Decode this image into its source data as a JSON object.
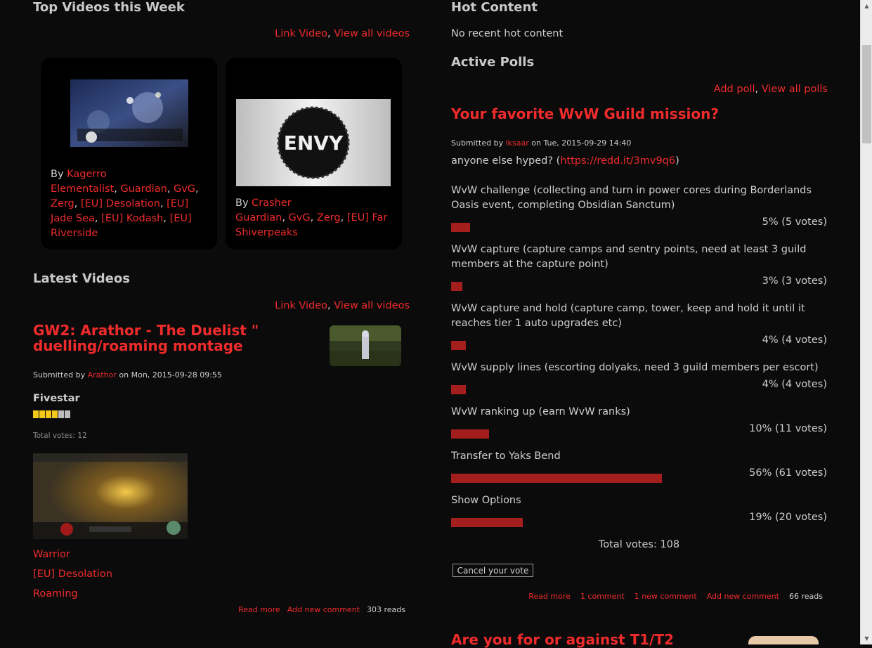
{
  "left": {
    "top_videos": {
      "heading": "Top Videos this Week",
      "link_video": "Link Video",
      "sep": ", ",
      "view_all": "View all videos",
      "cards": [
        {
          "by": "By ",
          "author": "Kagerro",
          "tags": [
            "Elementalist",
            "Guardian",
            "GvG",
            "Zerg",
            "[EU] Desolation",
            "[EU] Jade Sea",
            "[EU] Kodash",
            "[EU] Riverside"
          ]
        },
        {
          "by": "By ",
          "author": "Crasher",
          "tags": [
            "Guardian",
            "GvG",
            "Zerg",
            "[EU] Far Shiverpeaks"
          ],
          "logo_text": "ENVY"
        }
      ]
    },
    "latest_videos": {
      "heading": "Latest Videos",
      "link_video": "Link Video",
      "sep": ", ",
      "view_all": "View all videos",
      "post": {
        "title": "GW2: Arathor - The Duelist \" duelling/roaming montage",
        "submitted_by": "Submitted by ",
        "author": "Arathor",
        "date": " on Mon, 2015-09-28 09:55",
        "fivestar_label": "Fivestar",
        "rating": 4,
        "rating_max": 6,
        "total_votes": "Total votes: 12",
        "tags": [
          "Warrior",
          "[EU] Desolation",
          "Roaming"
        ],
        "read_more": "Read more",
        "add_comment": "Add new comment",
        "reads": "303 reads"
      }
    }
  },
  "right": {
    "hot_content": {
      "heading": "Hot Content",
      "empty": "No recent hot content"
    },
    "active_polls": {
      "heading": "Active Polls",
      "add_poll": "Add poll",
      "sep": ", ",
      "view_all": "View all polls",
      "poll": {
        "title": "Your favorite WvW Guild mission?",
        "submitted_by": "Submitted by ",
        "author": "lksaar",
        "date": " on Tue, 2015-09-29 14:40",
        "body_text": "anyone else hyped? (",
        "body_link": "https://redd.it/3mv9q6",
        "body_end": ")",
        "options": [
          {
            "label": "WvW challenge (collecting and turn in power cores during Borderlands Oasis event, completing Obsidian Sanctum)",
            "result": "5% (5 votes)",
            "percent": 5
          },
          {
            "label": "WvW capture (capture camps and sentry points, need at least 3 guild members at the capture point)",
            "result": "3% (3 votes)",
            "percent": 3
          },
          {
            "label": "WvW capture and hold (capture camp, tower, keep and hold it until it reaches tier 1 auto upgrades etc)",
            "result": "4% (4 votes)",
            "percent": 4
          },
          {
            "label": "WvW supply lines (escorting dolyaks, need 3 guild members per escort)",
            "result": "4% (4 votes)",
            "percent": 4
          },
          {
            "label": "WvW ranking up (earn WvW ranks)",
            "result": "10% (11 votes)",
            "percent": 10
          },
          {
            "label": "Transfer to Yaks Bend",
            "result": "56% (61 votes)",
            "percent": 56
          },
          {
            "label": "Show Options",
            "result": "19% (20 votes)",
            "percent": 19
          }
        ],
        "total_votes": "Total votes: 108",
        "cancel_vote": "Cancel your vote",
        "read_more": "Read more",
        "comments": "1 comment",
        "new_comment": "1 new comment",
        "add_comment": "Add new comment",
        "reads": "66 reads"
      },
      "next_title": "Are you for or against T1/T2"
    }
  },
  "colors": {
    "background": "#0b0b0c",
    "link": "#ef2b2b",
    "bar": "#a41e1e",
    "text": "#cfcfcf",
    "star_on": "#f2c81a",
    "star_off": "#bdbdbd"
  }
}
